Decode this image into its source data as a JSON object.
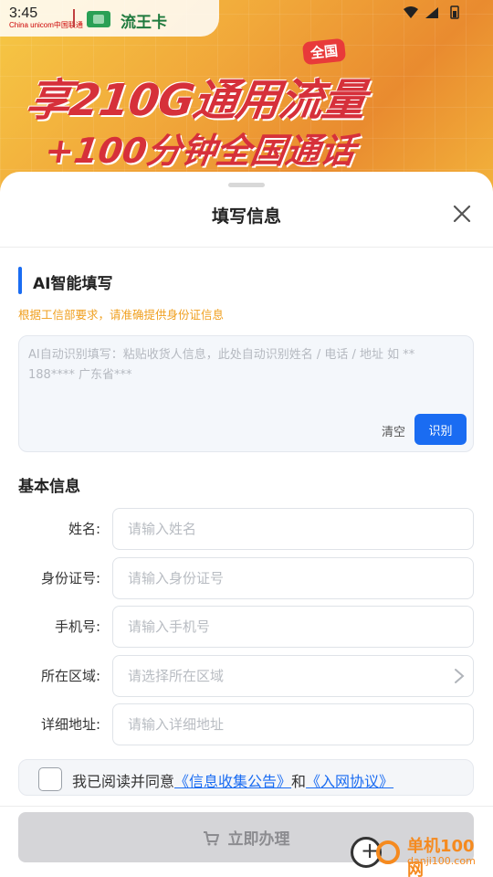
{
  "status_bar": {
    "time": "3:45",
    "carrier": "China unicom中国联通",
    "brand": "流王卡",
    "icons": "▼ ◢ ▮"
  },
  "banner": {
    "tag": "全国",
    "line1": "享210G通用流量",
    "line2": "+100分钟全国通话"
  },
  "sheet": {
    "title": "填写信息",
    "close_icon": "close-icon"
  },
  "ai_fill": {
    "title": "AI智能填写",
    "hint": "根据工信部要求，请准确提供身份证信息",
    "placeholder": "AI自动识别填写：粘贴收货人信息，此处自动识别姓名 / 电话 / 地址 如 ** 188**** 广东省***",
    "clear_label": "清空",
    "recognize_label": "识别"
  },
  "basic_info": {
    "title": "基本信息",
    "fields": [
      {
        "label": "姓名:",
        "placeholder": "请输入姓名"
      },
      {
        "label": "身份证号:",
        "placeholder": "请输入身份证号"
      },
      {
        "label": "手机号:",
        "placeholder": "请输入手机号"
      },
      {
        "label": "所在区域:",
        "placeholder": "请选择所在区域"
      },
      {
        "label": "详细地址:",
        "placeholder": "请输入详细地址"
      }
    ]
  },
  "agreement": {
    "prefix": "我已阅读并同意",
    "link1": "《信息收集公告》",
    "joiner": "和",
    "link2": "《入网协议》"
  },
  "footer": {
    "submit_label": "立即办理",
    "submit_icon": "cart-icon"
  },
  "watermark": {
    "name": "单机100网",
    "url": "danji100.com"
  },
  "colors": {
    "accent": "#1a6cf2",
    "hint": "#f0a020",
    "disabled_button": "#d5d5d8"
  }
}
